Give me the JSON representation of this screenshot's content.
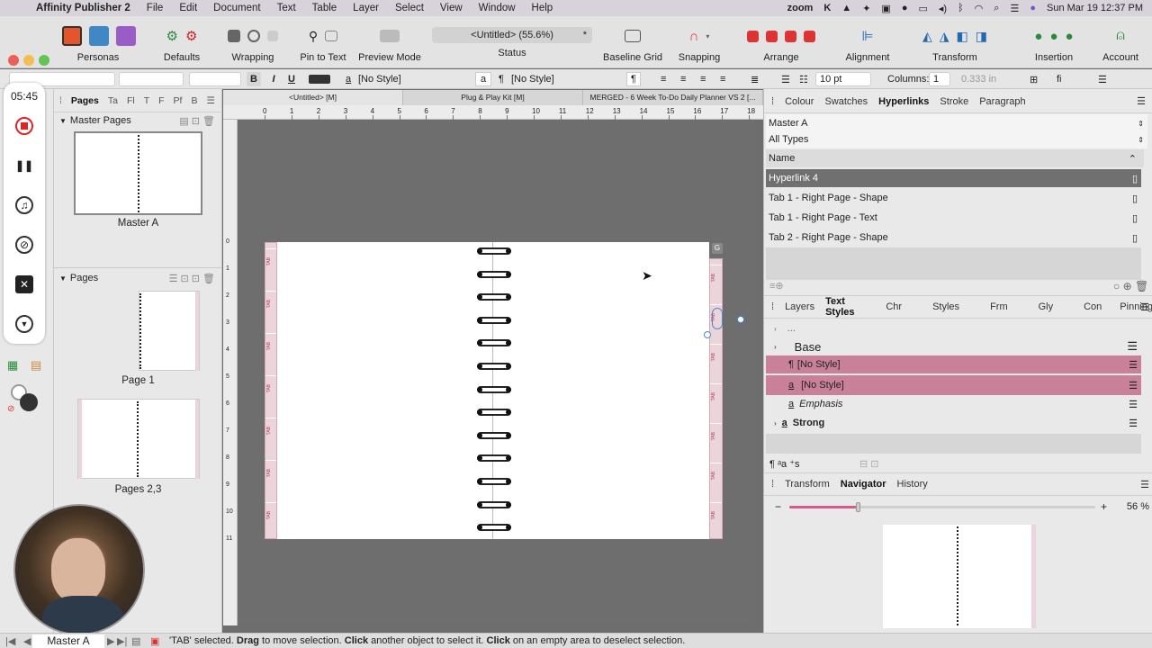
{
  "menubar": {
    "app": "Affinity Publisher 2",
    "items": [
      "File",
      "Edit",
      "Document",
      "Text",
      "Table",
      "Layer",
      "Select",
      "View",
      "Window",
      "Help"
    ],
    "zoom": "zoom",
    "datetime": "Sun Mar 19  12:37 PM"
  },
  "toolbar": {
    "personas": "Personas",
    "defaults": "Defaults",
    "wrapping": "Wrapping",
    "pin_to_text": "Pin to Text",
    "preview_mode": "Preview Mode",
    "doc_title": "<Untitled> (55.6%)",
    "doc_modified": "*",
    "status": "Status",
    "baseline_grid": "Baseline Grid",
    "snapping": "Snapping",
    "arrange": "Arrange",
    "alignment": "Alignment",
    "transform": "Transform",
    "insertion": "Insertion",
    "account": "Account"
  },
  "context": {
    "bold": "B",
    "italic": "I",
    "underline": "U",
    "char_style": "[No Style]",
    "char_prefix": "a",
    "para_prefix": "¶",
    "para_style": "[No Style]",
    "pilcrow": "¶",
    "font_size": "10 pt",
    "columns_label": "Columns:",
    "columns_value": "1",
    "gutter": "0.333 in",
    "ligature": "fi"
  },
  "recorder": {
    "time": "05:45"
  },
  "pages_panel": {
    "tabs": [
      "Pages",
      "Ta",
      "Fl",
      "T",
      "F",
      "Pf",
      "B"
    ],
    "master_header": "Master Pages",
    "master_name": "Master A",
    "pages_header": "Pages",
    "page1": "Page 1",
    "pages23": "Pages 2,3"
  },
  "doc_tabs": [
    "<Untitled> [M]",
    "Plug & Play Kit [M]",
    "MERGED - 6 Week To-Do Daily Planner VS 2 [..."
  ],
  "ruler_h": [
    "0",
    "1",
    "2",
    "3",
    "4",
    "5",
    "6",
    "7",
    "8",
    "9",
    "10",
    "11",
    "12",
    "13",
    "14",
    "15",
    "16",
    "17",
    "18"
  ],
  "ruler_v": [
    "0",
    "1",
    "2",
    "3",
    "4",
    "5",
    "6",
    "7",
    "8",
    "9",
    "10",
    "11"
  ],
  "tab_text": "TAB",
  "statusbar": {
    "page": "Master A",
    "msg_sel": "'TAB' selected. ",
    "drag": "Drag",
    "msg_move": " to move selection. ",
    "click": "Click",
    "msg_another": " another object to select it. ",
    "click2": "Click",
    "msg_empty": " on an empty area to deselect selection."
  },
  "right_top": {
    "tabs": [
      "Colour",
      "Swatches",
      "Hyperlinks",
      "Stroke",
      "Paragraph"
    ],
    "master": "Master A",
    "types": "All Types",
    "col_name": "Name",
    "rows": [
      "Hyperlink 4",
      "Tab 1 - Right Page - Shape",
      "Tab 1 - Right Page - Text",
      "Tab 2 - Right Page - Shape"
    ]
  },
  "right_mid": {
    "tabs": [
      "Layers",
      "Text Styles",
      "Chr",
      "Styles",
      "Frm",
      "Gly",
      "Con",
      "Pinning"
    ],
    "ellipsis": "...",
    "base": "Base",
    "styles": [
      {
        "icon": "¶",
        "name": "[No Style]"
      },
      {
        "icon": "a",
        "name": "[No Style]"
      },
      {
        "icon": "a",
        "name": "Emphasis"
      },
      {
        "icon": "a",
        "name": "Strong"
      }
    ]
  },
  "right_bottom": {
    "tabs": [
      "Transform",
      "Navigator",
      "History"
    ],
    "zoom": "56 %",
    "zoom_fraction": 0.56
  },
  "colors": {
    "accent": "#c9819a",
    "selected_row": "#707070",
    "record": "#e02424"
  }
}
